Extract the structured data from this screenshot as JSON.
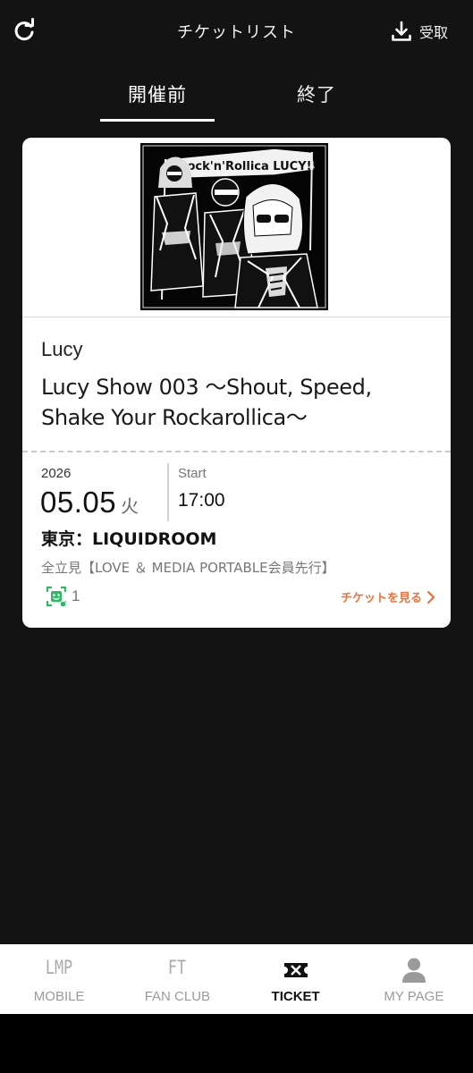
{
  "header": {
    "title": "チケットリスト",
    "receive_label": "受取",
    "refresh_icon": "refresh-icon",
    "receive_icon": "download-icon"
  },
  "tabs": [
    {
      "label": "開催前",
      "active": true
    },
    {
      "label": "終了",
      "active": false
    }
  ],
  "ticket": {
    "artist": "Lucy",
    "title": "Lucy Show 003 〜Shout, Speed, Shake Your Rockarollica〜",
    "year": "2026",
    "date": "05.05",
    "weekday": "火",
    "start_label": "Start",
    "start_time": "17:00",
    "venue": "東京：LIQUIDROOM",
    "seat": "全立見【LOVE ＆ MEDIA PORTABLE会員先行】",
    "quantity": "1",
    "view_label": "チケットを見る",
    "artwork_text": "Rock'n'Rollica LUCY!!"
  },
  "nav": [
    {
      "label": "MOBILE",
      "icon": "LMP",
      "active": false
    },
    {
      "label": "FAN CLUB",
      "icon": "FT",
      "active": false
    },
    {
      "label": "TICKET",
      "icon": "ticket-icon",
      "active": true
    },
    {
      "label": "MY PAGE",
      "icon": "person-icon",
      "active": false
    }
  ],
  "colors": {
    "background": "#131313",
    "card": "#ffffff",
    "accent": "#e8743b",
    "qr_green": "#2fb86a"
  }
}
